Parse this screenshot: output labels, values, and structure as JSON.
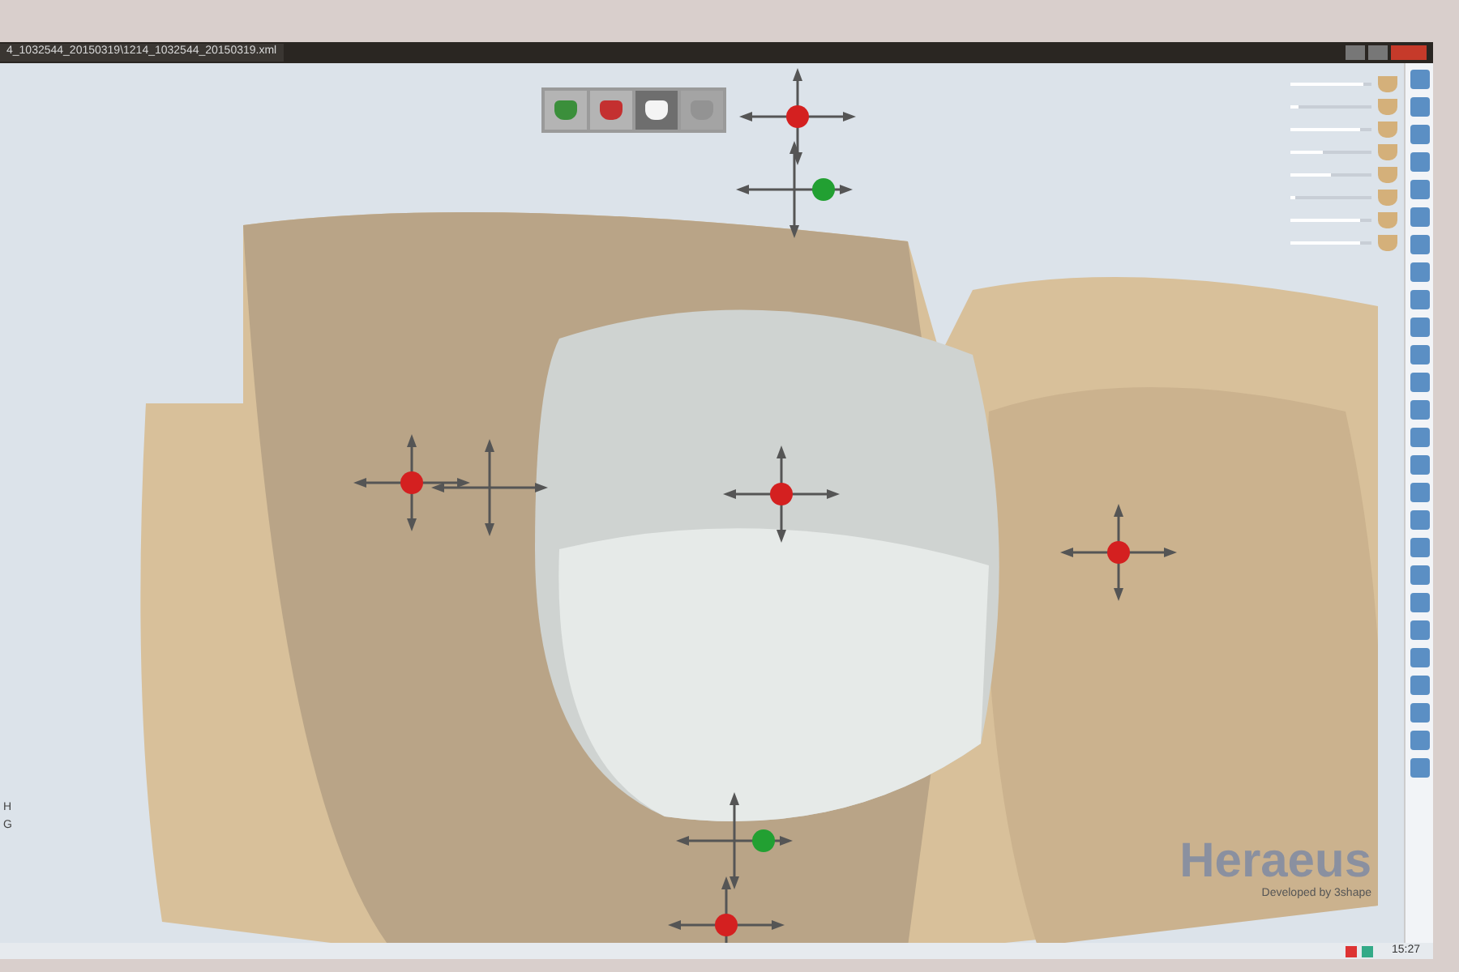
{
  "window": {
    "title": "4_1032544_20150319\\1214_1032544_20150319.xml"
  },
  "toolbar": {
    "tools": [
      {
        "kind": "prep",
        "selected": false,
        "disabled": false
      },
      {
        "kind": "margin",
        "selected": false,
        "disabled": false
      },
      {
        "kind": "crown",
        "selected": true,
        "disabled": false
      },
      {
        "kind": "sculpt",
        "selected": false,
        "disabled": true
      }
    ]
  },
  "sliders": [
    {
      "level": 0.9
    },
    {
      "level": 0.1
    },
    {
      "level": 0.85
    },
    {
      "level": 0.4
    },
    {
      "level": 0.5
    },
    {
      "level": 0.05
    },
    {
      "level": 0.85
    },
    {
      "level": 0.85
    }
  ],
  "side_labels": [
    "H",
    "G"
  ],
  "logo": {
    "brand": "Heraeus",
    "tagline": "Developed by 3shape"
  },
  "taskbar": {
    "clock": "15:27"
  }
}
